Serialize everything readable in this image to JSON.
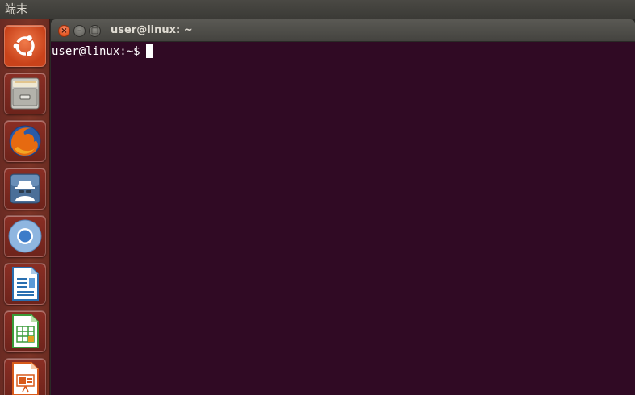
{
  "top_panel": {
    "title": "端末"
  },
  "launcher": {
    "items": [
      {
        "icon": "ubuntu-dash-icon",
        "color": "#e95420"
      },
      {
        "icon": "file-cabinet-icon",
        "color": "#9a9a96"
      },
      {
        "icon": "firefox-icon",
        "color": "#e66000"
      },
      {
        "icon": "spy-agent-icon",
        "color": "#5d7fa8"
      },
      {
        "icon": "chromium-icon",
        "color": "#4a86c8"
      },
      {
        "icon": "writer-document-icon",
        "color": "#2a6fb0"
      },
      {
        "icon": "calc-spreadsheet-icon",
        "color": "#3a9c3a"
      },
      {
        "icon": "impress-presentation-icon",
        "color": "#d85a1a"
      }
    ]
  },
  "window": {
    "title": "user@linux: ~",
    "close_glyph": "×",
    "min_glyph": "–",
    "max_glyph": "□"
  },
  "terminal": {
    "prompt": "user@linux:~$",
    "background": "#300a24",
    "foreground": "#ffffff"
  }
}
